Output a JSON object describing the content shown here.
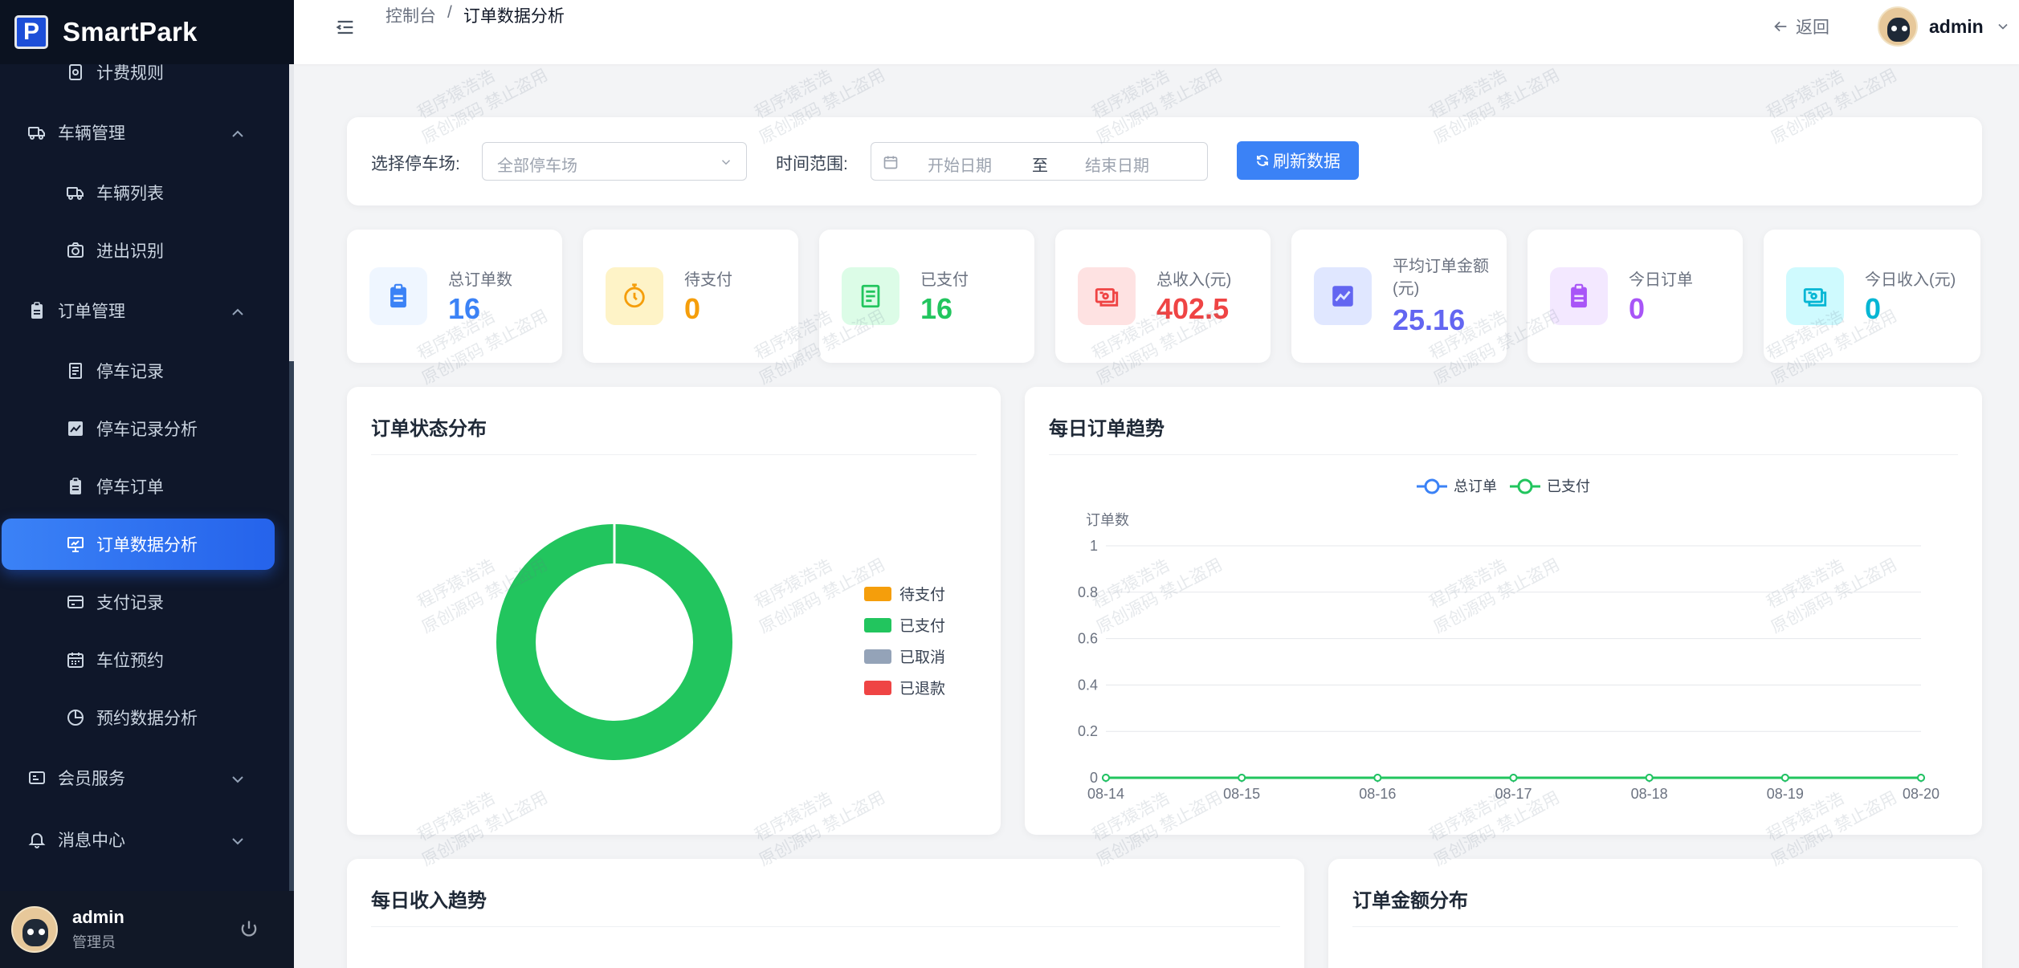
{
  "app": {
    "logo_letter": "P",
    "name": "SmartPark"
  },
  "sidebar": {
    "items": [
      {
        "label": "计费规则",
        "icon": "fee-rule-icon"
      },
      {
        "label": "车辆管理",
        "icon": "truck-icon",
        "group": true
      },
      {
        "label": "车辆列表",
        "icon": "truck-icon"
      },
      {
        "label": "进出识别",
        "icon": "camera-icon"
      },
      {
        "label": "订单管理",
        "icon": "clipboard-icon",
        "group": true
      },
      {
        "label": "停车记录",
        "icon": "document-icon"
      },
      {
        "label": "停车记录分析",
        "icon": "chart-icon"
      },
      {
        "label": "停车订单",
        "icon": "clipboard-icon"
      },
      {
        "label": "订单数据分析",
        "icon": "presentation-chart-icon",
        "active": true
      },
      {
        "label": "支付记录",
        "icon": "credit-card-icon"
      },
      {
        "label": "车位预约",
        "icon": "calendar-icon"
      },
      {
        "label": "预约数据分析",
        "icon": "pie-chart-icon"
      },
      {
        "label": "会员服务",
        "icon": "member-card-icon",
        "group": true
      },
      {
        "label": "消息中心",
        "icon": "bell-icon",
        "group": true
      }
    ],
    "user": {
      "name": "admin",
      "role": "管理员"
    }
  },
  "header": {
    "breadcrumb": [
      "控制台",
      "/",
      "订单数据分析"
    ],
    "back_label": "返回",
    "user_name": "admin"
  },
  "filter": {
    "park_label": "选择停车场:",
    "park_placeholder": "全部停车场",
    "range_label": "时间范围:",
    "start_placeholder": "开始日期",
    "to": "至",
    "end_placeholder": "结束日期",
    "refresh_label": "刷新数据"
  },
  "stats": [
    {
      "label": "总订单数",
      "value": "16",
      "color": "#3b82f6",
      "bg": "#eff6ff",
      "icon": "clipboard-icon"
    },
    {
      "label": "待支付",
      "value": "0",
      "color": "#f59e0b",
      "bg": "#fef3c7",
      "icon": "stopwatch-icon"
    },
    {
      "label": "已支付",
      "value": "16",
      "color": "#22c55e",
      "bg": "#dcfce7",
      "icon": "receipt-icon"
    },
    {
      "label": "总收入(元)",
      "value": "402.5",
      "color": "#ef4444",
      "bg": "#fee2e2",
      "icon": "money-icon"
    },
    {
      "label": "平均订单金额(元)",
      "value": "25.16",
      "color": "#6366f1",
      "bg": "#e0e7ff",
      "icon": "trend-icon"
    },
    {
      "label": "今日订单",
      "value": "0",
      "color": "#a855f7",
      "bg": "#f3e8ff",
      "icon": "clipboard-icon"
    },
    {
      "label": "今日收入(元)",
      "value": "0",
      "color": "#06b6d4",
      "bg": "#cffafe",
      "icon": "money-icon"
    }
  ],
  "panels": {
    "status_title": "订单状态分布",
    "trend_title": "每日订单趋势",
    "income_title": "每日收入趋势",
    "amount_title": "订单金额分布"
  },
  "watermark": {
    "line1": "程序猿浩浩",
    "line2": "原创源码 禁止盗用"
  },
  "chart_data": [
    {
      "type": "pie",
      "title": "订单状态分布",
      "donut": true,
      "categories": [
        "待支付",
        "已支付",
        "已取消",
        "已退款"
      ],
      "values": [
        0,
        16,
        0,
        0
      ],
      "colors": [
        "#f59e0b",
        "#22c55e",
        "#94a3b8",
        "#ef4444"
      ],
      "legend": "right"
    },
    {
      "type": "line",
      "title": "每日订单趋势",
      "ylabel": "订单数",
      "x": [
        "08-14",
        "08-15",
        "08-16",
        "08-17",
        "08-18",
        "08-19",
        "08-20"
      ],
      "series": [
        {
          "name": "总订单",
          "values": [
            0,
            0,
            0,
            0,
            0,
            0,
            0
          ],
          "color": "#3b82f6"
        },
        {
          "name": "已支付",
          "values": [
            0,
            0,
            0,
            0,
            0,
            0,
            0
          ],
          "color": "#22c55e"
        }
      ],
      "yticks": [
        "0",
        "0.2",
        "0.4",
        "0.6",
        "0.8",
        "1"
      ],
      "ylim": [
        0,
        1
      ],
      "legend": "top-center",
      "grid": true
    }
  ]
}
